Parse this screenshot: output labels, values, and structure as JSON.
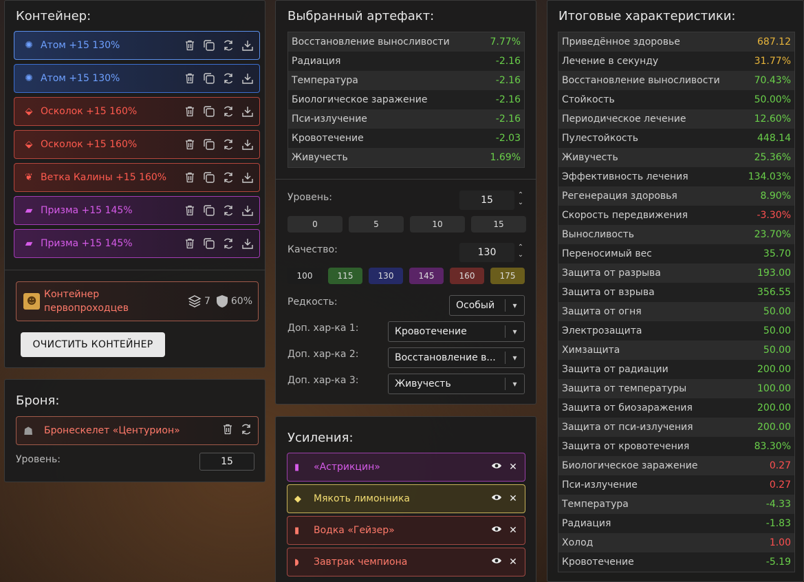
{
  "container": {
    "title": "Контейнер:",
    "artifacts": [
      {
        "name": "Атом +15 130%",
        "rarity": "blue",
        "icon": "atom-icon"
      },
      {
        "name": "Атом +15 130%",
        "rarity": "blue",
        "icon": "atom-icon"
      },
      {
        "name": "Осколок +15 160%",
        "rarity": "red",
        "icon": "shard-icon"
      },
      {
        "name": "Осколок +15 160%",
        "rarity": "red",
        "icon": "shard-icon"
      },
      {
        "name": "Ветка Калины +15 160%",
        "rarity": "red",
        "icon": "branch-icon"
      },
      {
        "name": "Призма +15 145%",
        "rarity": "purple",
        "icon": "prism-icon"
      },
      {
        "name": "Призма +15 145%",
        "rarity": "purple",
        "icon": "prism-icon"
      }
    ],
    "card": {
      "name_line1": "Контейнер",
      "name_line2": "первопроходцев",
      "slots": "7",
      "protection": "60%"
    },
    "clear_button": "ОЧИСТИТЬ КОНТЕЙНЕР"
  },
  "armor": {
    "title": "Броня:",
    "name": "Бронескелет «Центурион»",
    "level_label": "Уровень:",
    "level_value": "15"
  },
  "artifact": {
    "title": "Выбранный артефакт:",
    "stats": [
      {
        "label": "Восстановление выносливости",
        "value": "7.77%",
        "color": "green"
      },
      {
        "label": "Радиация",
        "value": "-2.16",
        "color": "green"
      },
      {
        "label": "Температура",
        "value": "-2.16",
        "color": "green"
      },
      {
        "label": "Биологическое заражение",
        "value": "-2.16",
        "color": "green"
      },
      {
        "label": "Пси-излучение",
        "value": "-2.16",
        "color": "green"
      },
      {
        "label": "Кровотечение",
        "value": "-2.03",
        "color": "green"
      },
      {
        "label": "Живучесть",
        "value": "1.69%",
        "color": "green"
      }
    ],
    "level_label": "Уровень:",
    "level_value": "15",
    "level_presets": [
      "0",
      "5",
      "10",
      "15"
    ],
    "quality_label": "Качество:",
    "quality_value": "130",
    "quality_presets": [
      {
        "label": "100",
        "color": "#1c1c1c"
      },
      {
        "label": "115",
        "color": "#2f5f2c"
      },
      {
        "label": "130",
        "color": "#252a66"
      },
      {
        "label": "145",
        "color": "#5a2466"
      },
      {
        "label": "160",
        "color": "#6a2a28"
      },
      {
        "label": "175",
        "color": "#6a5d1c"
      }
    ],
    "rarity_label": "Редкость:",
    "rarity_value": "Особый",
    "extra1_label": "Доп. хар-ка 1:",
    "extra1_value": "Кровотечение",
    "extra2_label": "Доп. хар-ка 2:",
    "extra2_value": "Восстановление в...",
    "extra3_label": "Доп. хар-ка 3:",
    "extra3_value": "Живучесть"
  },
  "boosts": {
    "title": "Усиления:",
    "items": [
      {
        "name": "«Астрикцин»",
        "style": "purple"
      },
      {
        "name": "Мякоть лимонника",
        "style": "yellow"
      },
      {
        "name": "Водка «Гейзер»",
        "style": "red"
      },
      {
        "name": "Завтрак чемпиона",
        "style": "red"
      }
    ]
  },
  "final": {
    "title": "Итоговые характеристики:",
    "stats": [
      {
        "label": "Приведённое здоровье",
        "value": "687.12",
        "color": "yellow"
      },
      {
        "label": "Лечение в секунду",
        "value": "31.77%",
        "color": "yellow"
      },
      {
        "label": "Восстановление выносливости",
        "value": "70.43%",
        "color": "green"
      },
      {
        "label": "Стойкость",
        "value": "50.00%",
        "color": "green"
      },
      {
        "label": "Периодическое лечение",
        "value": "12.60%",
        "color": "green"
      },
      {
        "label": "Пулестойкость",
        "value": "448.14",
        "color": "green"
      },
      {
        "label": "Живучесть",
        "value": "25.36%",
        "color": "green"
      },
      {
        "label": "Эффективность лечения",
        "value": "134.03%",
        "color": "green"
      },
      {
        "label": "Регенерация здоровья",
        "value": "8.90%",
        "color": "green"
      },
      {
        "label": "Скорость передвижения",
        "value": "-3.30%",
        "color": "red"
      },
      {
        "label": "Выносливость",
        "value": "23.70%",
        "color": "green"
      },
      {
        "label": "Переносимый вес",
        "value": "35.70",
        "color": "green"
      },
      {
        "label": "Защита от разрыва",
        "value": "193.00",
        "color": "green"
      },
      {
        "label": "Защита от взрыва",
        "value": "356.55",
        "color": "green"
      },
      {
        "label": "Защита от огня",
        "value": "50.00",
        "color": "green"
      },
      {
        "label": "Электрозащита",
        "value": "50.00",
        "color": "green"
      },
      {
        "label": "Химзащита",
        "value": "50.00",
        "color": "green"
      },
      {
        "label": "Защита от радиации",
        "value": "200.00",
        "color": "green"
      },
      {
        "label": "Защита от температуры",
        "value": "100.00",
        "color": "green"
      },
      {
        "label": "Защита от биозаражения",
        "value": "200.00",
        "color": "green"
      },
      {
        "label": "Защита от пси-излучения",
        "value": "200.00",
        "color": "green"
      },
      {
        "label": "Защита от кровотечения",
        "value": "83.30%",
        "color": "green"
      },
      {
        "label": "Биологическое заражение",
        "value": "0.27",
        "color": "red"
      },
      {
        "label": "Пси-излучение",
        "value": "0.27",
        "color": "red"
      },
      {
        "label": "Температура",
        "value": "-4.33",
        "color": "green"
      },
      {
        "label": "Радиация",
        "value": "-1.83",
        "color": "green"
      },
      {
        "label": "Холод",
        "value": "1.00",
        "color": "red"
      },
      {
        "label": "Кровотечение",
        "value": "-5.19",
        "color": "green"
      }
    ]
  }
}
